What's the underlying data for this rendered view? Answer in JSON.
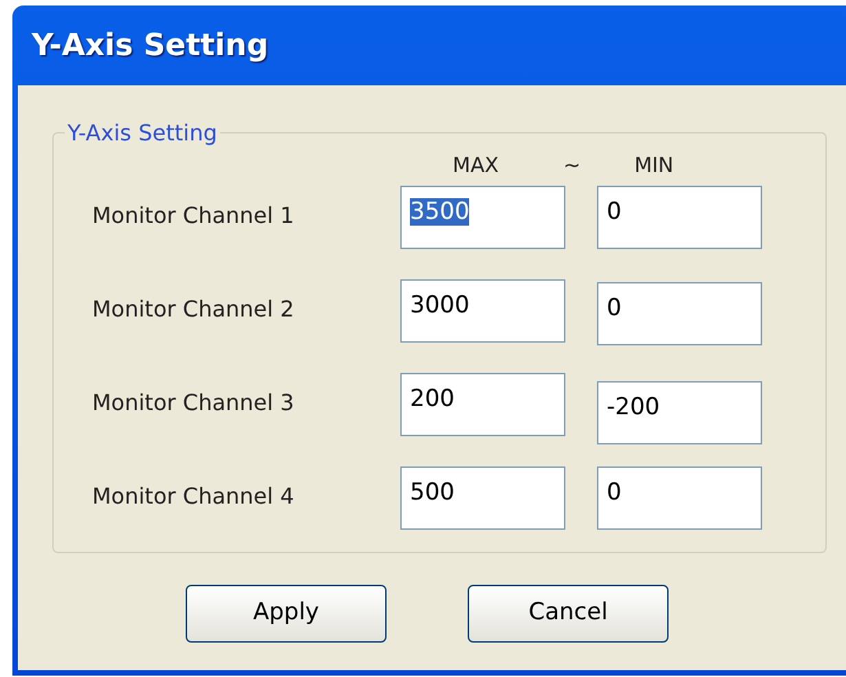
{
  "window": {
    "title": "Y-Axis Setting"
  },
  "group": {
    "title": "Y-Axis Setting",
    "headers": {
      "max": "MAX",
      "separator": "~",
      "min": "MIN"
    }
  },
  "channels": [
    {
      "label": "Monitor Channel 1",
      "max": {
        "value": "3500",
        "selected": true
      },
      "min": {
        "value": "0",
        "selected": false
      }
    },
    {
      "label": "Monitor Channel 2",
      "max": {
        "value": "3000",
        "selected": false
      },
      "min": {
        "value": "0",
        "selected": false
      }
    },
    {
      "label": "Monitor Channel 3",
      "max": {
        "value": "200",
        "selected": false
      },
      "min": {
        "value": "-200",
        "selected": false
      }
    },
    {
      "label": "Monitor Channel 4",
      "max": {
        "value": "500",
        "selected": false
      },
      "min": {
        "value": "0",
        "selected": false
      }
    }
  ],
  "buttons": [
    "Apply",
    "Cancel"
  ]
}
